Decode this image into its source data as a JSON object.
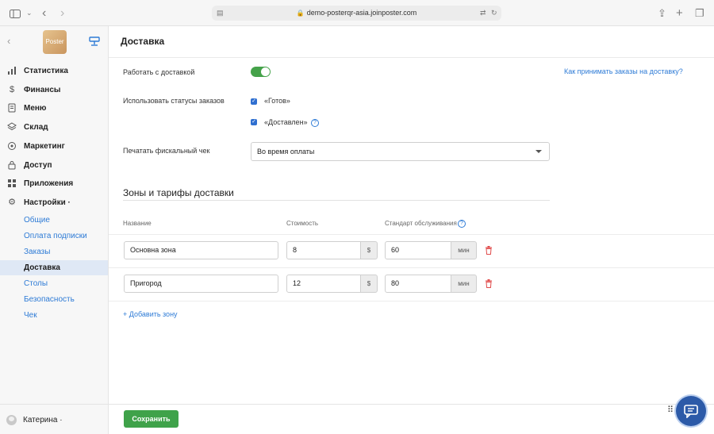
{
  "browser": {
    "url": "demo-posterqr-asia.joinposter.com",
    "icons": [
      "sidebar-icon",
      "chevron-down-icon",
      "back-icon",
      "forward-icon",
      "reader-icon",
      "lock-icon",
      "translate-icon",
      "reload-icon",
      "share-icon",
      "plus-icon",
      "tabs-icon"
    ]
  },
  "sidebar": {
    "logo_text": "Poster",
    "nav": [
      {
        "label": "Статистика",
        "icon": "bar-chart-icon"
      },
      {
        "label": "Финансы",
        "icon": "dollar-icon"
      },
      {
        "label": "Меню",
        "icon": "document-icon"
      },
      {
        "label": "Склад",
        "icon": "layers-icon"
      },
      {
        "label": "Маркетинг",
        "icon": "target-icon"
      },
      {
        "label": "Доступ",
        "icon": "lock-icon"
      },
      {
        "label": "Приложения",
        "icon": "grid-icon"
      },
      {
        "label": "Настройки ·",
        "icon": "gear-icon"
      }
    ],
    "settings_items": [
      {
        "label": "Общие",
        "active": false
      },
      {
        "label": "Оплата подписки",
        "active": false
      },
      {
        "label": "Заказы",
        "active": false
      },
      {
        "label": "Доставка",
        "active": true
      },
      {
        "label": "Столы",
        "active": false
      },
      {
        "label": "Безопасность",
        "active": false
      },
      {
        "label": "Чек",
        "active": false
      }
    ],
    "user_name": "Катерина ·"
  },
  "page": {
    "title": "Доставка",
    "help_link": "Как принимать заказы на доставку?",
    "work_with_delivery": {
      "label": "Работать с доставкой",
      "enabled": true
    },
    "order_statuses": {
      "label": "Использовать статусы заказов",
      "options": [
        {
          "label": "«Готов»",
          "checked": true
        },
        {
          "label": "«Доставлен»",
          "checked": true
        }
      ]
    },
    "fiscal": {
      "label": "Печатать фискальный чек",
      "value": "Во время оплаты"
    },
    "zones": {
      "title": "Зоны и тарифы доставки",
      "headers": {
        "name": "Название",
        "cost": "Стоимость",
        "standard": "Стандарт обслуживания"
      },
      "currency": "$",
      "unit": "мин",
      "rows": [
        {
          "name": "Основна зона",
          "cost": "8",
          "standard": "60"
        },
        {
          "name": "Пригород",
          "cost": "12",
          "standard": "80"
        }
      ],
      "add_label": "+ Добавить зону"
    },
    "save_label": "Сохранить"
  },
  "colors": {
    "accent": "#2e7bd6",
    "toggle_on": "#45a24a",
    "save": "#3fa24a",
    "delete": "#e04b4b",
    "chat": "#2c5aa8"
  }
}
